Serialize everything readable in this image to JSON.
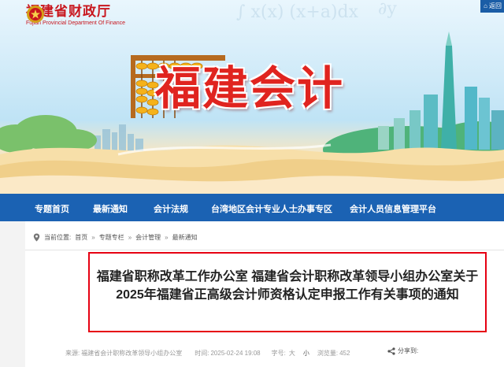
{
  "header": {
    "logo_cn": "福建省财政厅",
    "logo_en": "Fujian Provincial Department Of Finance",
    "corner_link": "返回",
    "banner_title": "福建会计"
  },
  "nav": {
    "items": [
      "专题首页",
      "最新通知",
      "会计法规",
      "台湾地区会计专业人士办事专区",
      "会计人员信息管理平台"
    ]
  },
  "breadcrumb": {
    "label": "当前位置:",
    "items": [
      "首页",
      "专题专栏",
      "会计管理",
      "最新通知"
    ],
    "separator": "»"
  },
  "article": {
    "title": "福建省职称改革工作办公室 福建省会计职称改革领导小组办公室关于2025年福建省正高级会计师资格认定申报工作有关事项的通知",
    "source_label": "来源:",
    "source": "福建省会计职称改革领导小组办公室",
    "time_label": "时间:",
    "time": "2025-02-24 19:08",
    "font_label": "字号:",
    "font_big": "大",
    "font_small": "小",
    "views_label": "浏览量:",
    "views": "452",
    "share_label": "分享到:"
  },
  "colors": {
    "brand_red": "#c8161d",
    "nav_blue": "#1b62b3",
    "title_border": "#e60012"
  }
}
